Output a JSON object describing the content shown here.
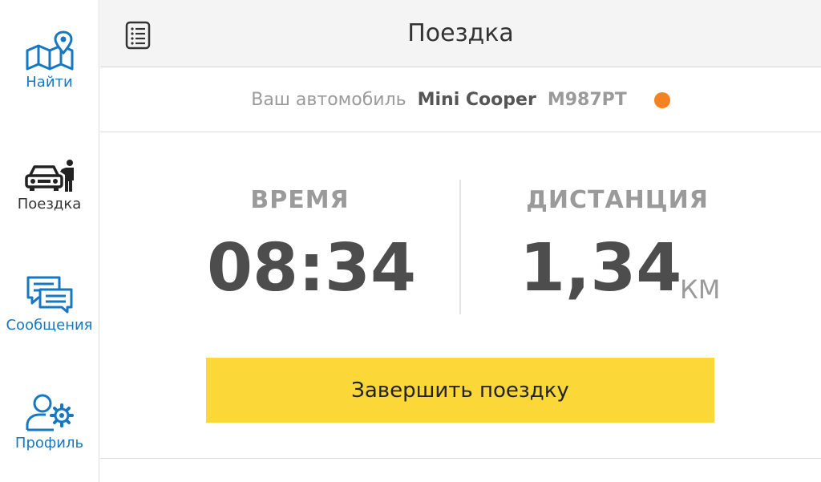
{
  "sidebar": {
    "items": [
      {
        "label": "Найти",
        "icon": "map-pin-icon",
        "active": false
      },
      {
        "label": "Поездка",
        "icon": "car-driver-icon",
        "active": true
      },
      {
        "label": "Сообщения",
        "icon": "chat-bubbles-icon",
        "active": false
      },
      {
        "label": "Профиль",
        "icon": "profile-settings-icon",
        "active": false
      }
    ]
  },
  "header": {
    "title": "Поездка",
    "menu_icon": "list-icon"
  },
  "car": {
    "prefix": "Ваш автомобиль",
    "model": "Mini Cooper",
    "plate": "M987PT",
    "status_color": "#f58220"
  },
  "stats": {
    "time_label": "ВРЕМЯ",
    "time_value": "08:34",
    "distance_label": "ДИСТАНЦИЯ",
    "distance_value": "1,34",
    "distance_unit": "КМ"
  },
  "actions": {
    "finish_label": "Завершить поездку"
  },
  "colors": {
    "accent_blue": "#1778c2",
    "button_yellow": "#fbd738"
  }
}
